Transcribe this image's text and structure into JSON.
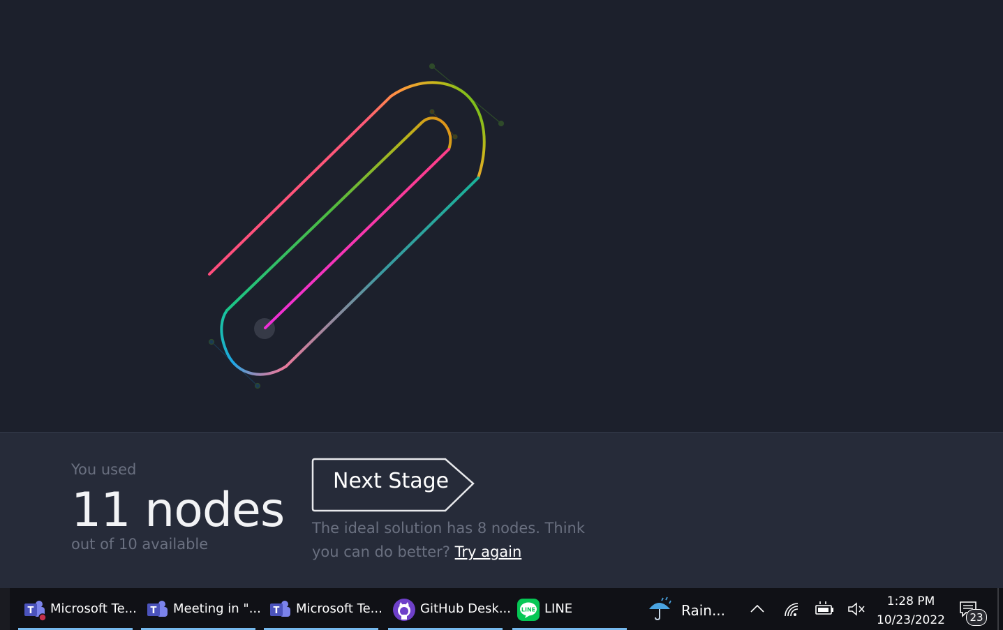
{
  "result": {
    "used_label": "You used",
    "nodes_count": "11 nodes",
    "available_label": "out of 10 available",
    "next_button": "Next Stage",
    "hint_text": "The ideal solution has 8 nodes. Think you can do better?",
    "try_again": "Try again"
  },
  "taskbar": {
    "apps": [
      {
        "label": "Microsoft Te...",
        "icon": "microsoft-teams-icon"
      },
      {
        "label": "Meeting in \"...",
        "icon": "microsoft-teams-icon"
      },
      {
        "label": "Microsoft Te...",
        "icon": "microsoft-teams-icon"
      },
      {
        "label": "GitHub Desk...",
        "icon": "github-desktop-icon"
      },
      {
        "label": "LINE",
        "icon": "line-app-icon"
      }
    ],
    "weather": "Rain...",
    "time": "1:28 PM",
    "date": "10/23/2022",
    "notifications": "23"
  },
  "colors": {
    "background": "#1c202c",
    "panel": "#262b39",
    "accent_underline": "#76b9ed"
  }
}
